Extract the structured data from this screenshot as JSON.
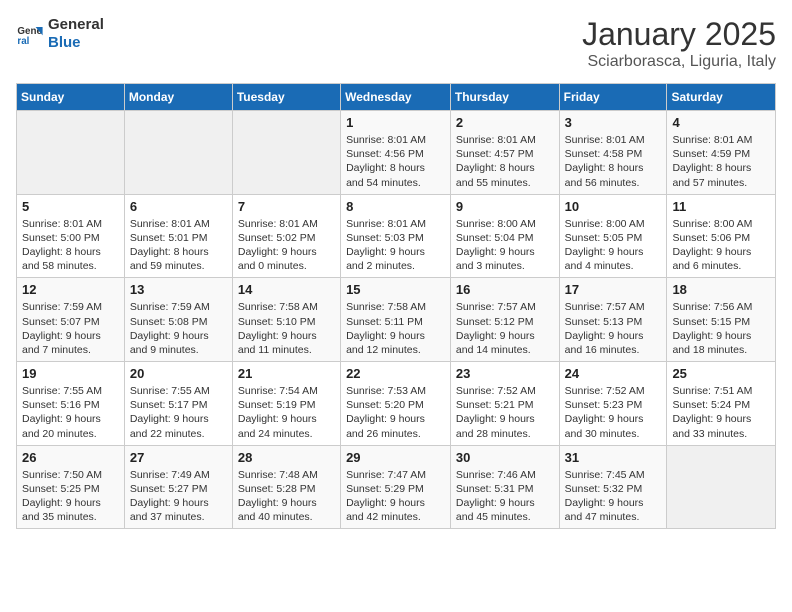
{
  "logo": {
    "line1": "General",
    "line2": "Blue"
  },
  "title": "January 2025",
  "subtitle": "Sciarborasca, Liguria, Italy",
  "days_of_week": [
    "Sunday",
    "Monday",
    "Tuesday",
    "Wednesday",
    "Thursday",
    "Friday",
    "Saturday"
  ],
  "weeks": [
    [
      {
        "num": "",
        "info": ""
      },
      {
        "num": "",
        "info": ""
      },
      {
        "num": "",
        "info": ""
      },
      {
        "num": "1",
        "info": "Sunrise: 8:01 AM\nSunset: 4:56 PM\nDaylight: 8 hours\nand 54 minutes."
      },
      {
        "num": "2",
        "info": "Sunrise: 8:01 AM\nSunset: 4:57 PM\nDaylight: 8 hours\nand 55 minutes."
      },
      {
        "num": "3",
        "info": "Sunrise: 8:01 AM\nSunset: 4:58 PM\nDaylight: 8 hours\nand 56 minutes."
      },
      {
        "num": "4",
        "info": "Sunrise: 8:01 AM\nSunset: 4:59 PM\nDaylight: 8 hours\nand 57 minutes."
      }
    ],
    [
      {
        "num": "5",
        "info": "Sunrise: 8:01 AM\nSunset: 5:00 PM\nDaylight: 8 hours\nand 58 minutes."
      },
      {
        "num": "6",
        "info": "Sunrise: 8:01 AM\nSunset: 5:01 PM\nDaylight: 8 hours\nand 59 minutes."
      },
      {
        "num": "7",
        "info": "Sunrise: 8:01 AM\nSunset: 5:02 PM\nDaylight: 9 hours\nand 0 minutes."
      },
      {
        "num": "8",
        "info": "Sunrise: 8:01 AM\nSunset: 5:03 PM\nDaylight: 9 hours\nand 2 minutes."
      },
      {
        "num": "9",
        "info": "Sunrise: 8:00 AM\nSunset: 5:04 PM\nDaylight: 9 hours\nand 3 minutes."
      },
      {
        "num": "10",
        "info": "Sunrise: 8:00 AM\nSunset: 5:05 PM\nDaylight: 9 hours\nand 4 minutes."
      },
      {
        "num": "11",
        "info": "Sunrise: 8:00 AM\nSunset: 5:06 PM\nDaylight: 9 hours\nand 6 minutes."
      }
    ],
    [
      {
        "num": "12",
        "info": "Sunrise: 7:59 AM\nSunset: 5:07 PM\nDaylight: 9 hours\nand 7 minutes."
      },
      {
        "num": "13",
        "info": "Sunrise: 7:59 AM\nSunset: 5:08 PM\nDaylight: 9 hours\nand 9 minutes."
      },
      {
        "num": "14",
        "info": "Sunrise: 7:58 AM\nSunset: 5:10 PM\nDaylight: 9 hours\nand 11 minutes."
      },
      {
        "num": "15",
        "info": "Sunrise: 7:58 AM\nSunset: 5:11 PM\nDaylight: 9 hours\nand 12 minutes."
      },
      {
        "num": "16",
        "info": "Sunrise: 7:57 AM\nSunset: 5:12 PM\nDaylight: 9 hours\nand 14 minutes."
      },
      {
        "num": "17",
        "info": "Sunrise: 7:57 AM\nSunset: 5:13 PM\nDaylight: 9 hours\nand 16 minutes."
      },
      {
        "num": "18",
        "info": "Sunrise: 7:56 AM\nSunset: 5:15 PM\nDaylight: 9 hours\nand 18 minutes."
      }
    ],
    [
      {
        "num": "19",
        "info": "Sunrise: 7:55 AM\nSunset: 5:16 PM\nDaylight: 9 hours\nand 20 minutes."
      },
      {
        "num": "20",
        "info": "Sunrise: 7:55 AM\nSunset: 5:17 PM\nDaylight: 9 hours\nand 22 minutes."
      },
      {
        "num": "21",
        "info": "Sunrise: 7:54 AM\nSunset: 5:19 PM\nDaylight: 9 hours\nand 24 minutes."
      },
      {
        "num": "22",
        "info": "Sunrise: 7:53 AM\nSunset: 5:20 PM\nDaylight: 9 hours\nand 26 minutes."
      },
      {
        "num": "23",
        "info": "Sunrise: 7:52 AM\nSunset: 5:21 PM\nDaylight: 9 hours\nand 28 minutes."
      },
      {
        "num": "24",
        "info": "Sunrise: 7:52 AM\nSunset: 5:23 PM\nDaylight: 9 hours\nand 30 minutes."
      },
      {
        "num": "25",
        "info": "Sunrise: 7:51 AM\nSunset: 5:24 PM\nDaylight: 9 hours\nand 33 minutes."
      }
    ],
    [
      {
        "num": "26",
        "info": "Sunrise: 7:50 AM\nSunset: 5:25 PM\nDaylight: 9 hours\nand 35 minutes."
      },
      {
        "num": "27",
        "info": "Sunrise: 7:49 AM\nSunset: 5:27 PM\nDaylight: 9 hours\nand 37 minutes."
      },
      {
        "num": "28",
        "info": "Sunrise: 7:48 AM\nSunset: 5:28 PM\nDaylight: 9 hours\nand 40 minutes."
      },
      {
        "num": "29",
        "info": "Sunrise: 7:47 AM\nSunset: 5:29 PM\nDaylight: 9 hours\nand 42 minutes."
      },
      {
        "num": "30",
        "info": "Sunrise: 7:46 AM\nSunset: 5:31 PM\nDaylight: 9 hours\nand 45 minutes."
      },
      {
        "num": "31",
        "info": "Sunrise: 7:45 AM\nSunset: 5:32 PM\nDaylight: 9 hours\nand 47 minutes."
      },
      {
        "num": "",
        "info": ""
      }
    ]
  ]
}
